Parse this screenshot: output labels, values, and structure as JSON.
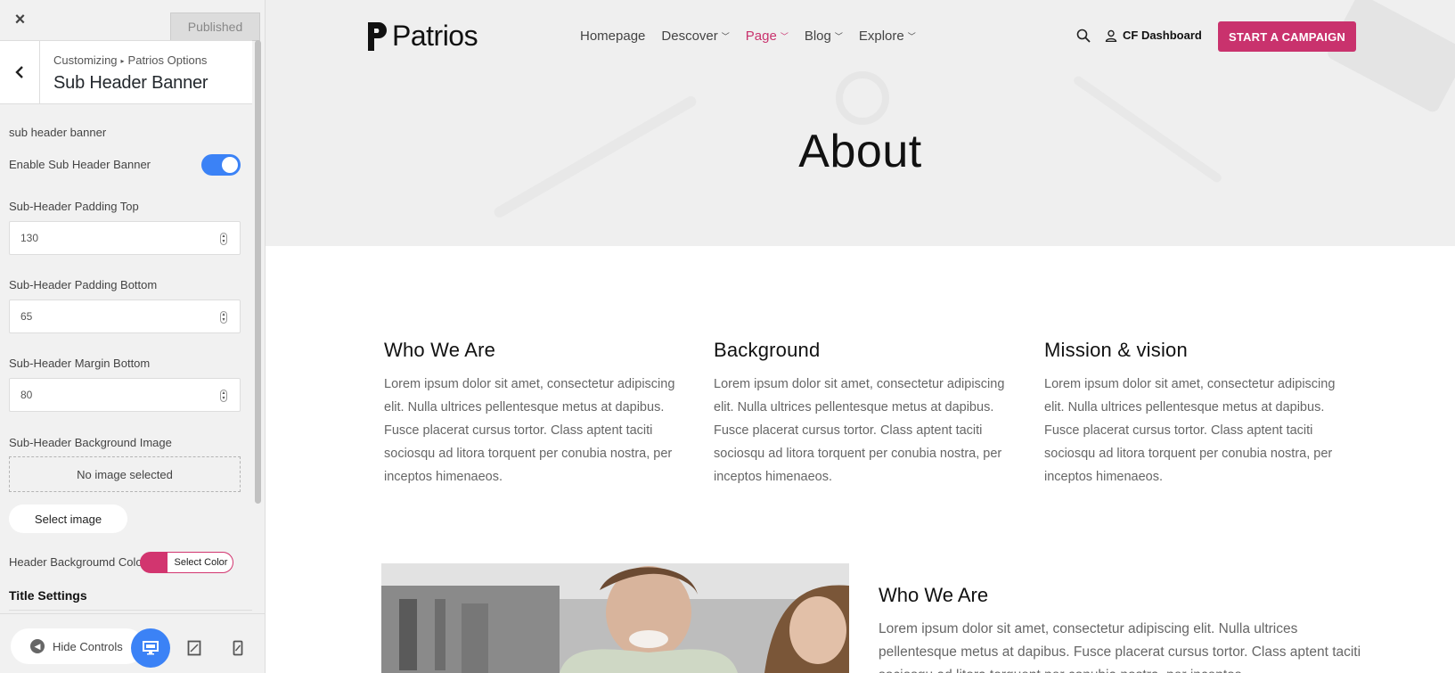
{
  "sidebar": {
    "close_label": "×",
    "published_label": "Published",
    "breadcrumb_root": "Customizing",
    "breadcrumb_sep": "▸",
    "breadcrumb_current": "Patrios Options",
    "section_title": "Sub Header Banner",
    "group_label": "sub header banner",
    "enable_label": "Enable Sub Header Banner",
    "enable_value": true,
    "padding_top_label": "Sub-Header Padding Top",
    "padding_top_value": "130",
    "padding_bottom_label": "Sub-Header Padding Bottom",
    "padding_bottom_value": "65",
    "margin_bottom_label": "Sub-Header Margin Bottom",
    "margin_bottom_value": "80",
    "bg_image_label": "Sub-Header Background Image",
    "no_image_text": "No image selected",
    "select_image_label": "Select image",
    "bg_color_label": "Header Backgroumd Color",
    "bg_color_button": "Select Color",
    "bg_color_value": "#d2356f",
    "title_settings": "Title Settings",
    "hide_controls": "Hide Controls"
  },
  "site": {
    "logo_text": "Patrios",
    "nav": [
      {
        "label": "Homepage",
        "dropdown": false
      },
      {
        "label": "Descover",
        "dropdown": true
      },
      {
        "label": "Page",
        "dropdown": true,
        "active": true
      },
      {
        "label": "Blog",
        "dropdown": true
      },
      {
        "label": "Explore",
        "dropdown": true
      }
    ],
    "user_link": "CF Dashboard",
    "cta": "START A CAMPAIGN",
    "accent_color": "#c9326d",
    "hero_title": "About",
    "columns": [
      {
        "title": "Who We Are",
        "text": "Lorem ipsum dolor sit amet, consectetur adipiscing elit. Nulla ultrices pellentesque metus at dapibus. Fusce placerat cursus tortor. Class aptent taciti sociosqu ad litora torquent per conubia nostra, per inceptos himenaeos."
      },
      {
        "title": "Background",
        "text": "Lorem ipsum dolor sit amet, consectetur adipiscing elit. Nulla ultrices pellentesque metus at dapibus. Fusce placerat cursus tortor. Class aptent taciti sociosqu ad litora torquent per conubia nostra, per inceptos himenaeos."
      },
      {
        "title": "Mission & vision",
        "text": "Lorem ipsum dolor sit amet, consectetur adipiscing elit. Nulla ultrices pellentesque metus at dapibus. Fusce placerat cursus tortor. Class aptent taciti sociosqu ad litora torquent per conubia nostra, per inceptos himenaeos."
      }
    ],
    "who2_title": "Who We Are",
    "who2_text": "Lorem ipsum dolor sit amet, consectetur adipiscing elit. Nulla ultrices pellentesque metus at dapibus. Fusce placerat cursus tortor. Class aptent taciti sociosqu ad litora torquent per conubia nostra, per inceptos"
  }
}
